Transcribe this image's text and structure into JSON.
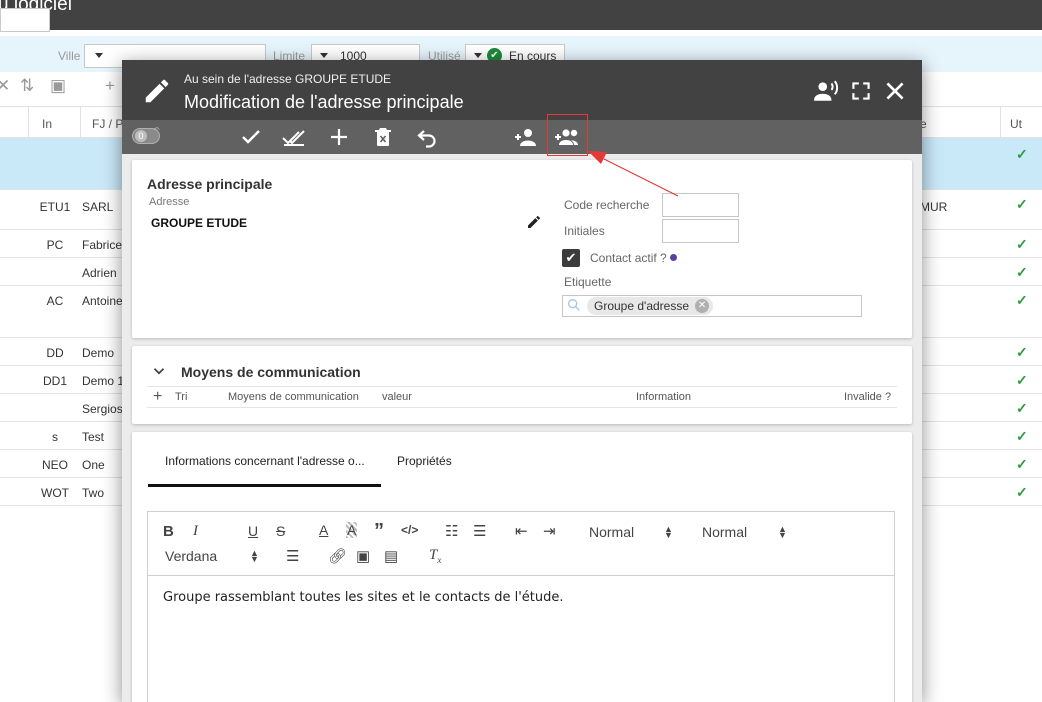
{
  "app": {
    "title": "u logiciel"
  },
  "filters": {
    "ville_label": "Ville",
    "limite_label": "Limite",
    "limite_value": "1000",
    "utilise_label": "Utilisé",
    "statut_value": "En cours"
  },
  "grid": {
    "headers": [
      "In",
      "FJ / P",
      "e",
      "Ut"
    ],
    "rows": [
      {
        "code": "",
        "name": "",
        "extra": "",
        "selected": true
      },
      {
        "code": "ETU1",
        "name": "SARL",
        "extra": "MUR"
      },
      {
        "code": "PC",
        "name": "Fabrice",
        "extra": ""
      },
      {
        "code": "",
        "name": "Adrien",
        "extra": ""
      },
      {
        "code": "AC",
        "name": "Antoine",
        "extra": ""
      },
      {
        "code": "DD",
        "name": "Demo",
        "extra": ""
      },
      {
        "code": "DD1",
        "name": "Demo 1",
        "extra": ""
      },
      {
        "code": "",
        "name": "Sergios",
        "extra": ""
      },
      {
        "code": "s",
        "name": "Test",
        "extra": ""
      },
      {
        "code": "NEO",
        "name": "One",
        "extra": ""
      },
      {
        "code": "WOT",
        "name": "Two",
        "extra": ""
      }
    ]
  },
  "dialog": {
    "subtitle": "Au sein de l'adresse GROUPE ETUDE",
    "title": "Modification de l'adresse principale",
    "toggle_count": "0"
  },
  "adresse": {
    "section_title": "Adresse principale",
    "adresse_label": "Adresse",
    "adresse_value": "GROUPE ETUDE",
    "code_recherche_label": "Code recherche",
    "initiales_label": "Initiales",
    "contact_actif_label": "Contact actif ?",
    "etiquette_label": "Etiquette",
    "tag_value": "Groupe d'adresse"
  },
  "communication": {
    "section_title": "Moyens de communication",
    "columns": [
      "Tri",
      "Moyens de communication",
      "valeur",
      "Information",
      "Invalide ?"
    ]
  },
  "tabs": {
    "tab1": "Informations concernant l'adresse o...",
    "tab2": "Propriétés"
  },
  "editor": {
    "format1": "Normal",
    "format2": "Normal",
    "font": "Verdana",
    "content": "Groupe rassemblant toutes les sites et le contacts de l'étude."
  },
  "colors": {
    "header_bg": "#424242",
    "toolbar_bg": "#616161",
    "accent_red": "#e53935",
    "check_green": "#2e9b3d"
  }
}
